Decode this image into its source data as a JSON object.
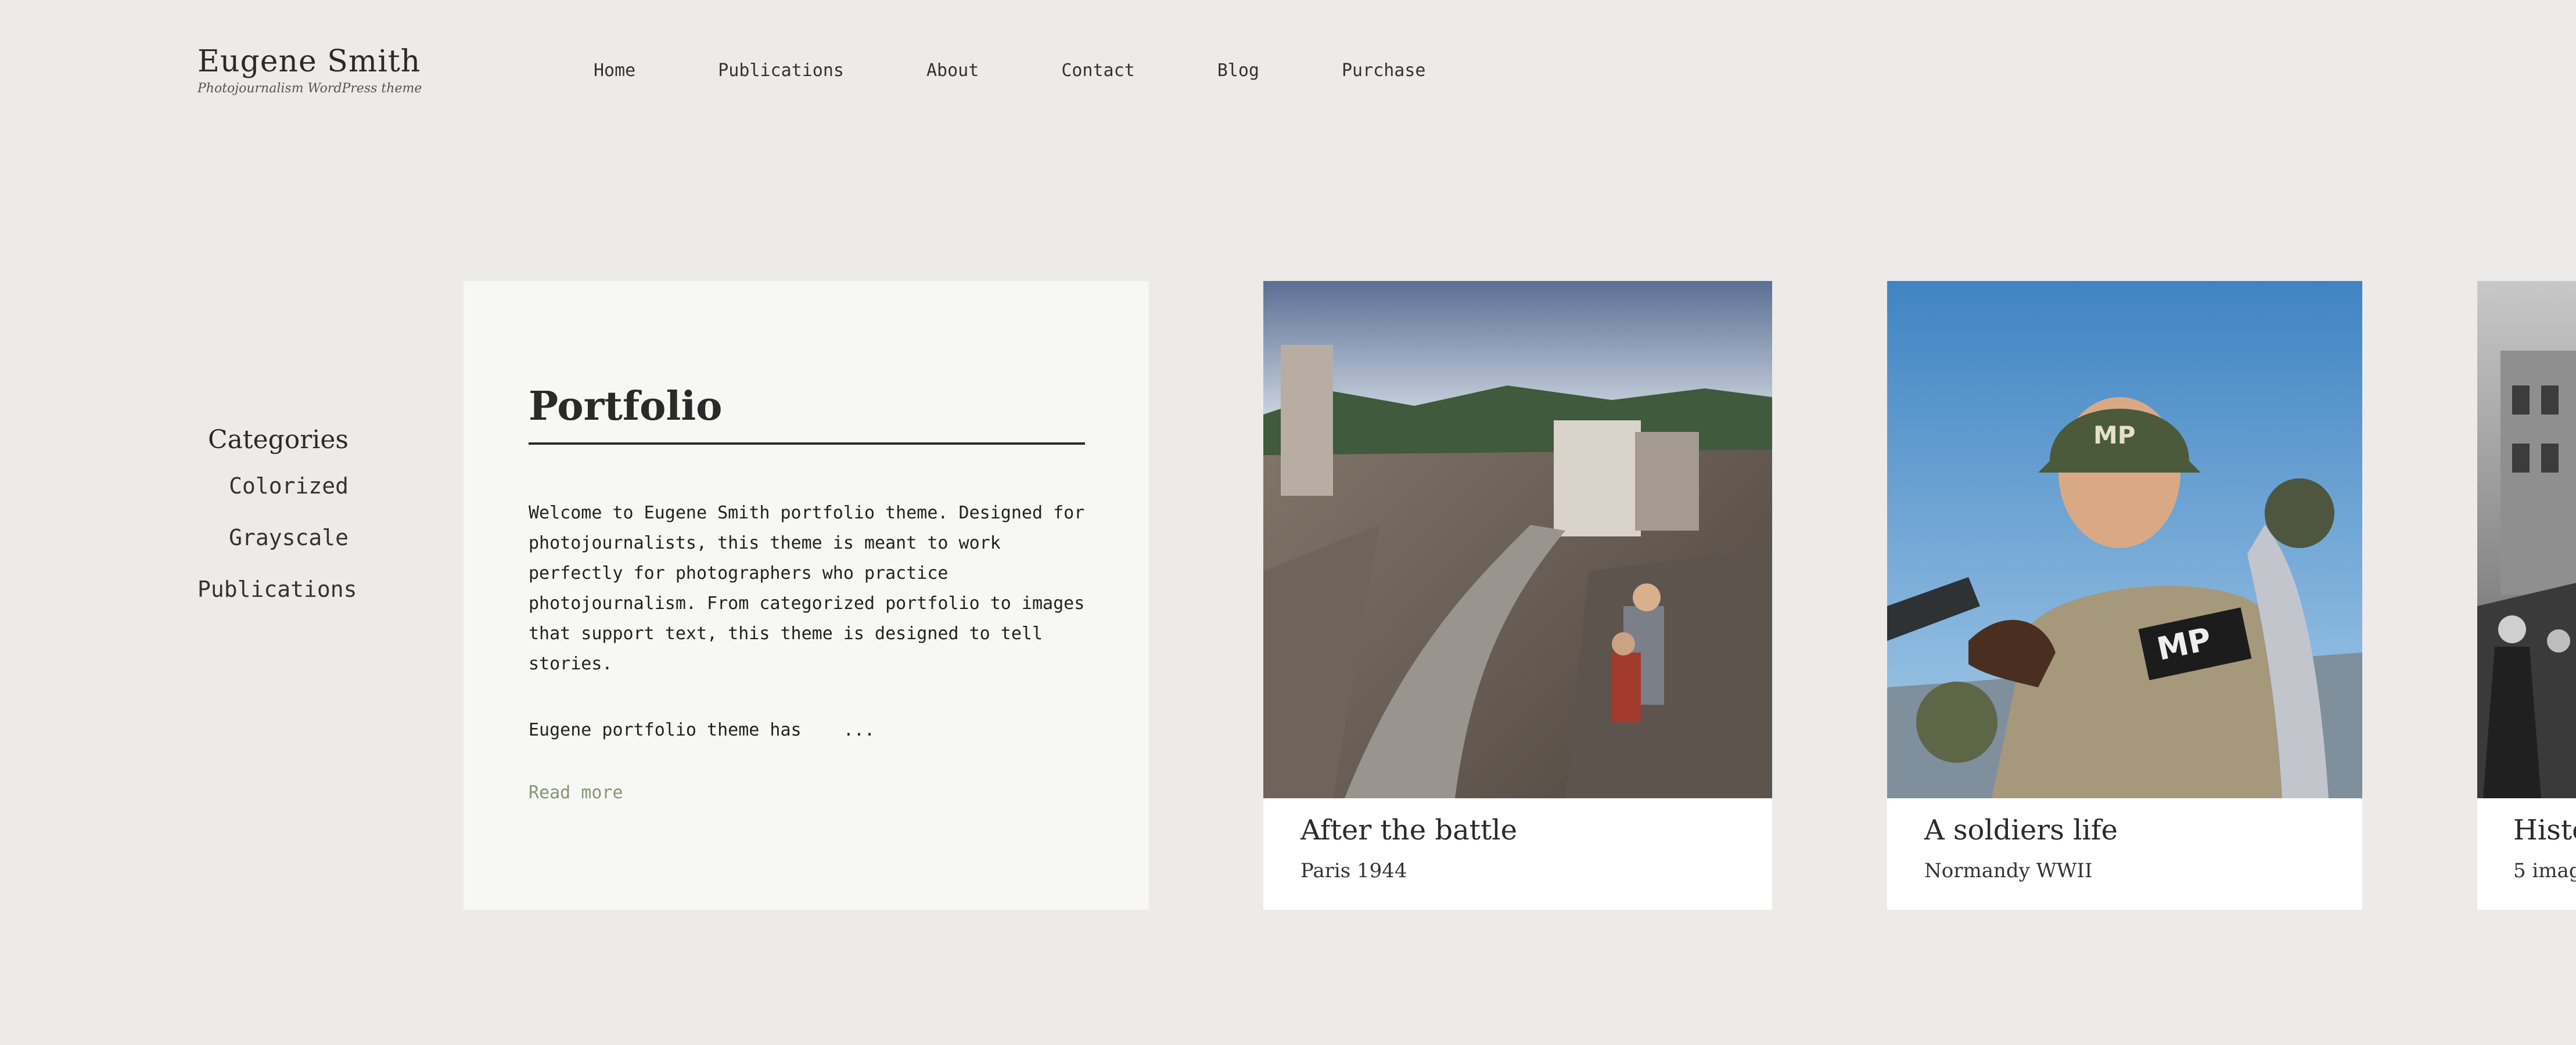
{
  "brand": {
    "title": "Eugene Smith",
    "tagline": "Photojournalism WordPress theme"
  },
  "nav": {
    "items": [
      "Home",
      "Publications",
      "About",
      "Contact",
      "Blog",
      "Purchase"
    ]
  },
  "sidebar": {
    "heading": "Categories",
    "items": [
      "Colorized",
      "Grayscale",
      "Publications"
    ]
  },
  "intro": {
    "title": "Portfolio",
    "text": "Welcome to Eugene Smith portfolio theme. Designed for photojournalists, this theme is meant to work perfectly for photographers who practice photojournalism. From categorized portfolio to images that support text, this theme is designed to tell stories.",
    "more_text": "Eugene portfolio theme has    ...",
    "read_more": "Read more"
  },
  "cards": [
    {
      "title": "After the battle",
      "subtitle": "Paris 1944",
      "icon": "war-ruins-photo"
    },
    {
      "title": "A soldiers life",
      "subtitle": "Normandy WWII",
      "icon": "soldier-portrait-photo"
    },
    {
      "title": "Histo",
      "subtitle": "5 imag",
      "icon": "grayscale-crowd-photo"
    }
  ],
  "colors": {
    "background": "#ecebe9",
    "card": "#f7f7f5",
    "accent_link": "#8b9474",
    "text": "#2a2a2a"
  }
}
